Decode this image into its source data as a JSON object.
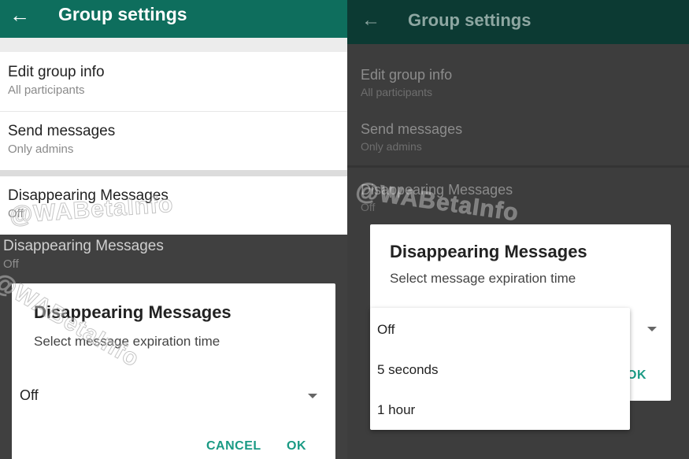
{
  "left": {
    "header": {
      "title": "Group settings",
      "back_icon": "arrow-back-icon"
    },
    "rows": [
      {
        "title": "Edit group info",
        "subtitle": "All participants"
      },
      {
        "title": "Send messages",
        "subtitle": "Only admins"
      },
      {
        "title": "Disappearing Messages",
        "subtitle": "Off"
      }
    ],
    "dimmed_row": {
      "title": "Disappearing Messages",
      "subtitle": "Off"
    },
    "dialog": {
      "title": "Disappearing Messages",
      "subtitle": "Select message expiration time",
      "selected": "Off",
      "cancel_label": "CANCEL",
      "ok_label": "OK"
    }
  },
  "right": {
    "header": {
      "title": "Group settings",
      "back_icon": "arrow-back-icon"
    },
    "rows": [
      {
        "title": "Edit group info",
        "subtitle": "All participants"
      },
      {
        "title": "Send messages",
        "subtitle": "Only admins"
      },
      {
        "title": "Disappearing Messages",
        "subtitle": "Off"
      }
    ],
    "dialog": {
      "title": "Disappearing Messages",
      "subtitle": "Select message expiration time",
      "ok_partial": "OK"
    },
    "dropdown_options": [
      "Off",
      "5 seconds",
      "1 hour"
    ]
  },
  "watermark": "@WABetaInfo",
  "colors": {
    "appbar": "#0e6e5d",
    "accent": "#1a9a84",
    "appbar_dimmed": "#0c3a33"
  }
}
